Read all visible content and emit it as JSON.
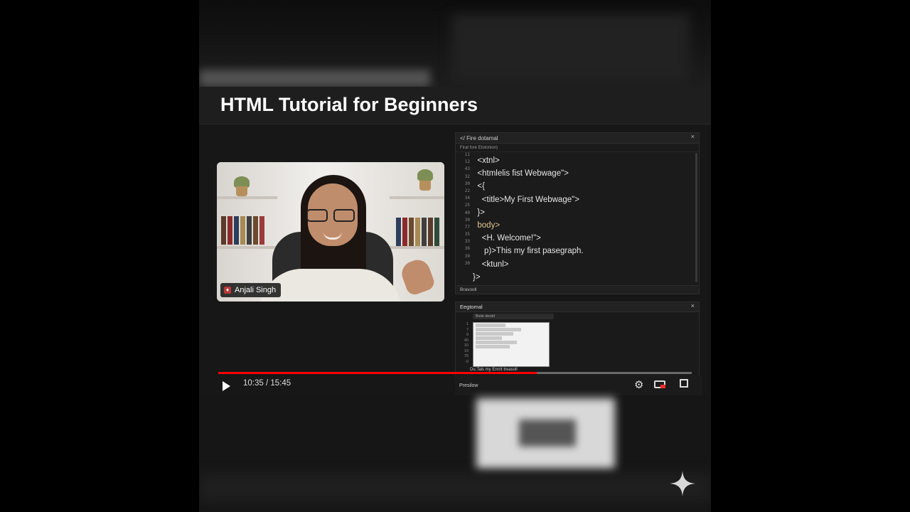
{
  "video": {
    "title": "HTML Tutorial for Beginners",
    "presenter_name": "Anjali Singh",
    "current_time": "10:35",
    "duration": "15:45",
    "time_display": "10:35 / 15:45",
    "progress": 0.672
  },
  "editor": {
    "tab_label": "</ Fire dotamal",
    "sub_label": "Firat fore Etotonion)",
    "close_label": "×",
    "line_numbers": [
      "11",
      "12",
      "43",
      "32",
      "30",
      "22",
      "34",
      "25",
      "49",
      "30",
      "77",
      "35",
      "33",
      "36",
      "39",
      "30"
    ],
    "code_lines": [
      "  <xtnl>",
      "  <htmlelis fist Webwage\">",
      "  <{",
      "    <title>My First Webwage\">",
      "  }>",
      "  body>",
      "    <H. Welcome!\">",
      "     p)>This my first pasegraph.",
      "    <ktunl>",
      "}>"
    ],
    "status_label": "Bravooll"
  },
  "preview": {
    "tab_label": "Eegtomal",
    "url_label": "Bviie doobl",
    "close_label": "×",
    "line_numbers": [
      "1",
      "7",
      "9",
      "40",
      "10",
      "19",
      "75",
      "-0"
    ],
    "bottom_label": "Du.Tals my Enrrit treasoll",
    "footer_label": "Presilow"
  },
  "controls": {
    "play_icon": "play-icon",
    "settings_icon": "gear-icon",
    "miniplayer_icon": "miniplayer-icon",
    "fullscreen_icon": "fullscreen-icon"
  },
  "colors": {
    "progress_fill": "#ff0000",
    "background": "#121212",
    "code_tag": "#e0c48a"
  }
}
